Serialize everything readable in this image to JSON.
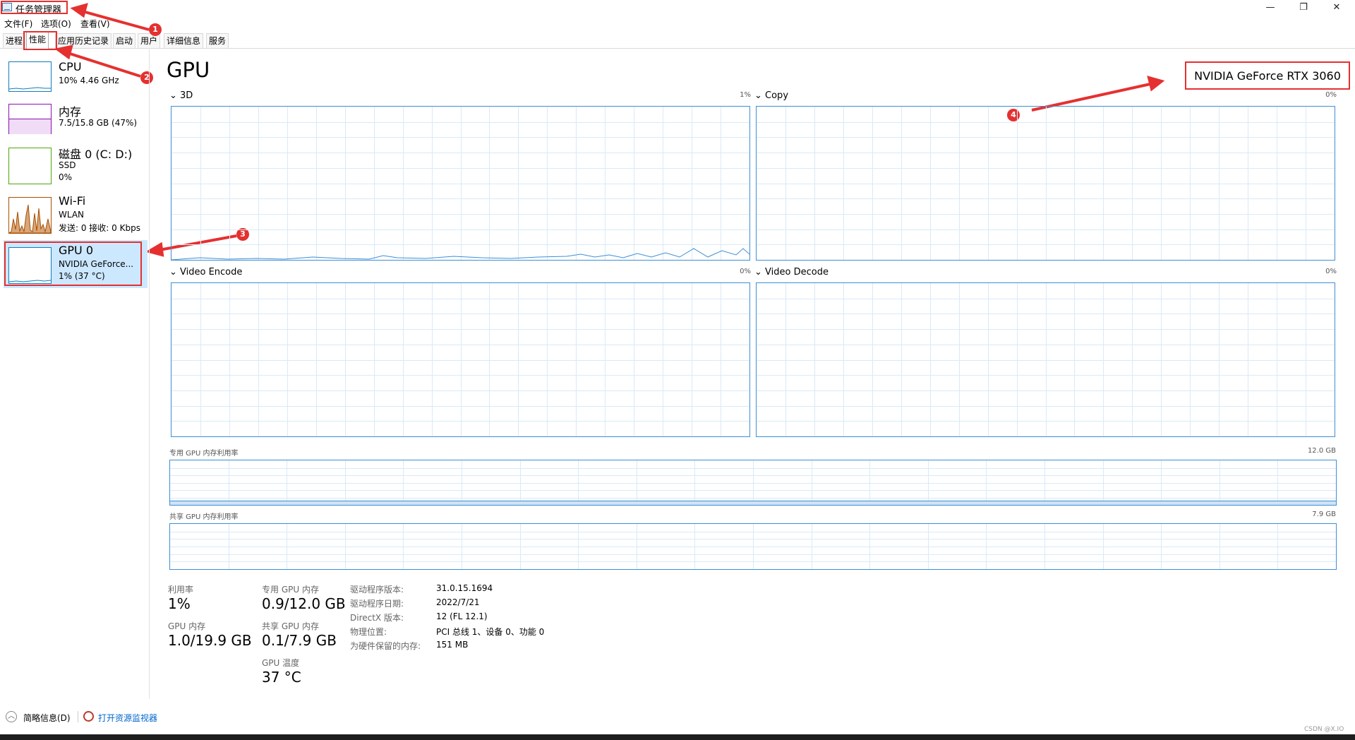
{
  "window": {
    "title": "任务管理器",
    "controls": {
      "minimize": "—",
      "maximize": "❐",
      "close": "✕"
    }
  },
  "menu": [
    "文件(F)",
    "选项(O)",
    "查看(V)"
  ],
  "tabs": [
    "进程",
    "性能",
    "应用历史记录",
    "启动",
    "用户",
    "详细信息",
    "服务"
  ],
  "active_tab": "性能",
  "markers": [
    "1",
    "2",
    "3",
    "4"
  ],
  "sidebar": {
    "items": [
      {
        "name": "CPU",
        "sub1": "10% 4.46 GHz",
        "sub2": "",
        "sub3": ""
      },
      {
        "name": "内存",
        "sub1": "7.5/15.8 GB (47%)",
        "sub2": "",
        "sub3": ""
      },
      {
        "name": "磁盘 0 (C: D:)",
        "sub1": "SSD",
        "sub2": "0%",
        "sub3": ""
      },
      {
        "name": "Wi-Fi",
        "sub1": "WLAN",
        "sub2": "发送: 0 接收: 0 Kbps",
        "sub3": ""
      },
      {
        "name": "GPU 0",
        "sub1": "NVIDIA GeForce...",
        "sub2": "1% (37 °C)",
        "sub3": ""
      }
    ],
    "colors": {
      "cpu": "#117dbb",
      "memory": "#8b12ae",
      "disk": "#4da60c",
      "wifi": "#a74f01",
      "gpu": "#117dbb"
    }
  },
  "main": {
    "title": "GPU",
    "model": "NVIDIA GeForce RTX 3060",
    "graphs": [
      {
        "label": "3D",
        "pct": "1%"
      },
      {
        "label": "Copy",
        "pct": "0%"
      },
      {
        "label": "Video Encode",
        "pct": "0%"
      },
      {
        "label": "Video Decode",
        "pct": "0%"
      }
    ],
    "dedicated_mem": {
      "label": "专用 GPU 内存利用率",
      "max": "12.0 GB"
    },
    "shared_mem": {
      "label": "共享 GPU 内存利用率",
      "max": "7.9 GB"
    },
    "stats": {
      "utilization_label": "利用率",
      "utilization": "1%",
      "gpu_mem_label": "GPU 内存",
      "gpu_mem": "1.0/19.9 GB",
      "dedicated_label": "专用 GPU 内存",
      "dedicated": "0.9/12.0 GB",
      "shared_label": "共享 GPU 内存",
      "shared": "0.1/7.9 GB",
      "temp_label": "GPU 温度",
      "temp": "37 °C"
    },
    "info": [
      {
        "key": "驱动程序版本:",
        "value": "31.0.15.1694"
      },
      {
        "key": "驱动程序日期:",
        "value": "2022/7/21"
      },
      {
        "key": "DirectX 版本:",
        "value": "12 (FL 12.1)"
      },
      {
        "key": "物理位置:",
        "value": "PCI 总线 1、设备 0、功能 0"
      },
      {
        "key": "为硬件保留的内存:",
        "value": "151 MB"
      }
    ]
  },
  "bottom": {
    "summary": "简略信息(D)",
    "resource_monitor": "打开资源监视器"
  },
  "watermark": "CSDN @X.IO",
  "accent": "#3d8fd6",
  "annotation_color": "#e53030"
}
